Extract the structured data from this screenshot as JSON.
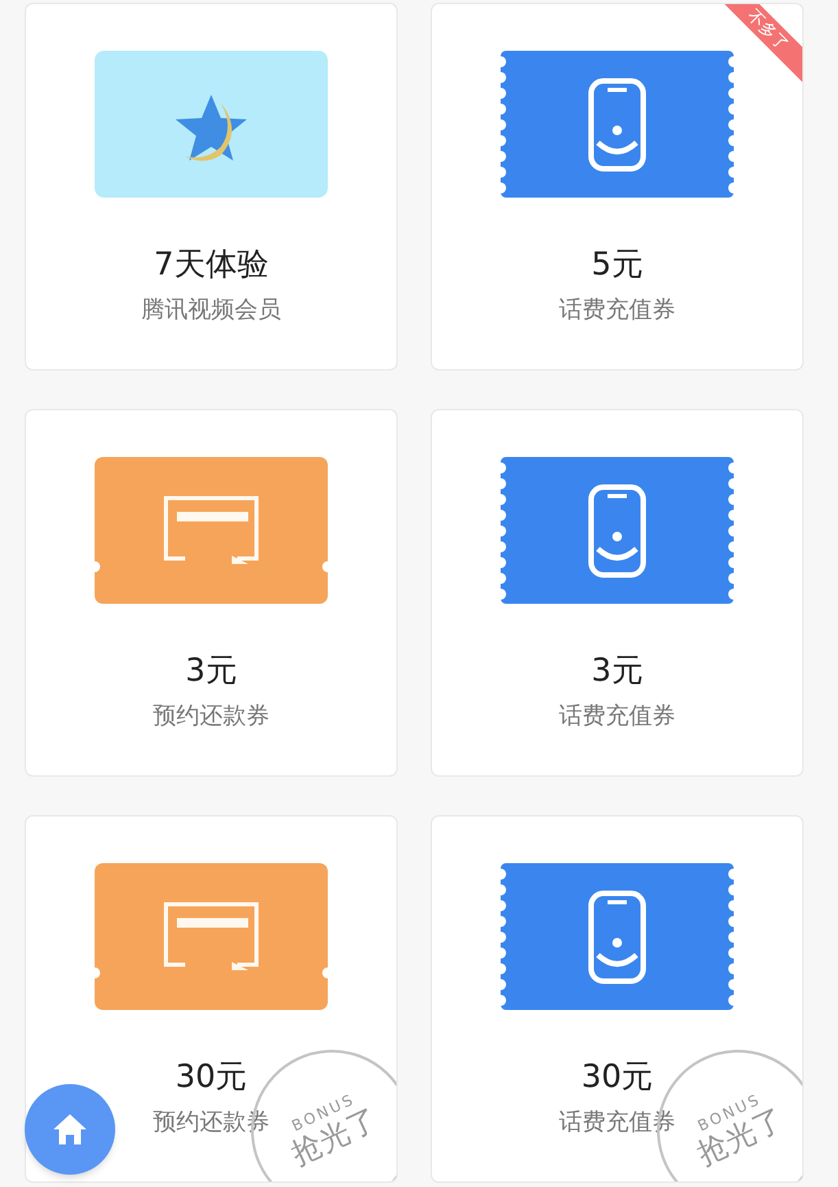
{
  "coupons": [
    {
      "kind": "vip",
      "title": "7天体验",
      "subtitle": "腾讯视频会员"
    },
    {
      "kind": "phone",
      "title": "5元",
      "subtitle": "话费充值券",
      "ribbon": "不多了"
    },
    {
      "kind": "repay",
      "title": "3元",
      "subtitle": "预约还款券"
    },
    {
      "kind": "phone",
      "title": "3元",
      "subtitle": "话费充值券"
    },
    {
      "kind": "repay",
      "title": "30元",
      "subtitle": "预约还款券",
      "stamp": {
        "top": "BONUS",
        "main": "抢光了"
      }
    },
    {
      "kind": "phone",
      "title": "30元",
      "subtitle": "话费充值券",
      "stamp": {
        "top": "BONUS",
        "main": "抢光了"
      }
    }
  ]
}
